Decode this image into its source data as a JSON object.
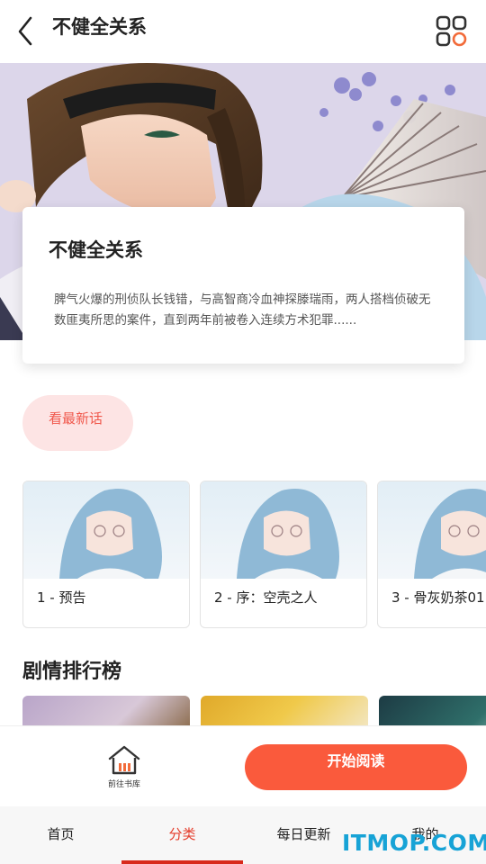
{
  "header": {
    "title": "不健全关系",
    "back_icon": "back-arrow-icon",
    "menu_icon": "grid-apps-icon"
  },
  "card": {
    "title": "不健全关系",
    "description": "脾气火爆的刑侦队长钱错，与高智商冷血神探滕瑞雨，两人搭档侦破无数匪夷所思的案件，直到两年前被卷入连续方术犯罪......"
  },
  "latest_button": "看最新话",
  "episodes": [
    {
      "label": "1 - 预告"
    },
    {
      "label": "2 - 序：空壳之人"
    },
    {
      "label": "3 - 骨灰奶茶01"
    }
  ],
  "ranking": {
    "title": "剧情排行榜"
  },
  "action_bar": {
    "library_label": "前往书库",
    "start_label": "开始阅读"
  },
  "tabs": [
    {
      "label": "首页"
    },
    {
      "label": "分类"
    },
    {
      "label": "每日更新"
    },
    {
      "label": "我的"
    }
  ],
  "watermark": "ITMOP.COM",
  "colors": {
    "accent": "#fa5a3c",
    "active_tab": "#e43b2a",
    "latest_bg": "#fde4e4",
    "latest_text": "#f0584c"
  }
}
